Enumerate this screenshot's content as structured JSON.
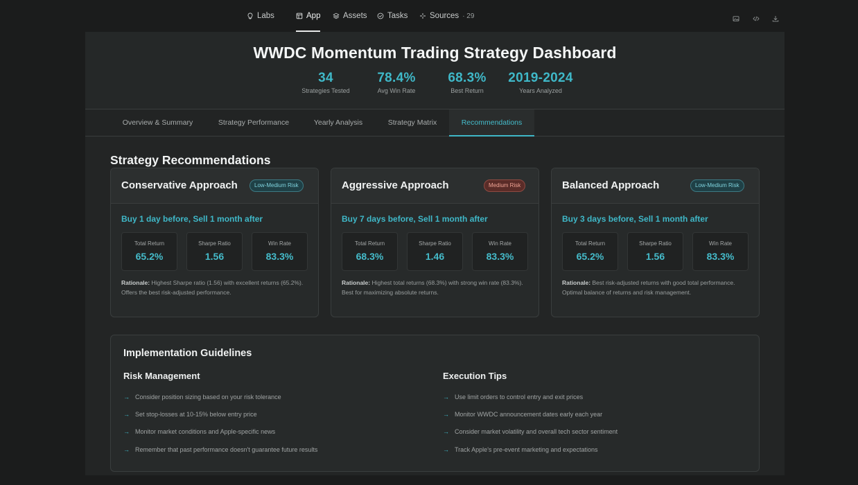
{
  "nav": {
    "items": [
      {
        "label": "Labs",
        "icon": "lightbulb-icon"
      },
      {
        "label": "App",
        "icon": "app-window-icon",
        "active": true
      },
      {
        "label": "Assets",
        "icon": "layers-icon"
      },
      {
        "label": "Tasks",
        "icon": "check-circle-icon"
      },
      {
        "label": "Sources",
        "icon": "sparkle-icon",
        "count": "29"
      }
    ],
    "right_icons": [
      "image-icon",
      "code-icon",
      "download-icon"
    ]
  },
  "hero": {
    "title": "WWDC Momentum Trading Strategy Dashboard",
    "stats": [
      {
        "value": "34",
        "label": "Strategies Tested"
      },
      {
        "value": "78.4%",
        "label": "Avg Win Rate"
      },
      {
        "value": "68.3%",
        "label": "Best Return"
      },
      {
        "value": "2019-2024",
        "label": "Years Analyzed"
      }
    ]
  },
  "tabs": [
    {
      "label": "Overview & Summary"
    },
    {
      "label": "Strategy Performance"
    },
    {
      "label": "Yearly Analysis"
    },
    {
      "label": "Strategy Matrix"
    },
    {
      "label": "Recommendations",
      "active": true
    }
  ],
  "recommendations": {
    "title": "Strategy Recommendations",
    "cards": [
      {
        "title": "Conservative Approach",
        "risk": "Low-Medium Risk",
        "strategy": "Buy 1 day before, Sell 1 month after",
        "metrics": [
          {
            "label": "Total Return",
            "value": "65.2%"
          },
          {
            "label": "Sharpe Ratio",
            "value": "1.56"
          },
          {
            "label": "Win Rate",
            "value": "83.3%"
          }
        ],
        "rationale_label": "Rationale:",
        "rationale": "Highest Sharpe ratio (1.56) with excellent returns (65.2%). Offers the best risk-adjusted performance."
      },
      {
        "title": "Aggressive Approach",
        "risk": "Medium Risk",
        "strategy": "Buy 7 days before, Sell 1 month after",
        "metrics": [
          {
            "label": "Total Return",
            "value": "68.3%"
          },
          {
            "label": "Sharpe Ratio",
            "value": "1.46"
          },
          {
            "label": "Win Rate",
            "value": "83.3%"
          }
        ],
        "rationale_label": "Rationale:",
        "rationale": "Highest total returns (68.3%) with strong win rate (83.3%). Best for maximizing absolute returns."
      },
      {
        "title": "Balanced Approach",
        "risk": "Low-Medium Risk",
        "strategy": "Buy 3 days before, Sell 1 month after",
        "metrics": [
          {
            "label": "Total Return",
            "value": "65.2%"
          },
          {
            "label": "Sharpe Ratio",
            "value": "1.56"
          },
          {
            "label": "Win Rate",
            "value": "83.3%"
          }
        ],
        "rationale_label": "Rationale:",
        "rationale": "Best risk-adjusted returns with good total performance. Optimal balance of returns and risk management."
      }
    ]
  },
  "guidelines": {
    "title": "Implementation Guidelines",
    "risk_title": "Risk Management",
    "risk_items": [
      "Consider position sizing based on your risk tolerance",
      "Set stop-losses at 10-15% below entry price",
      "Monitor market conditions and Apple-specific news",
      "Remember that past performance doesn't guarantee future results"
    ],
    "exec_title": "Execution Tips",
    "exec_items": [
      "Use limit orders to control entry and exit prices",
      "Monitor WWDC announcement dates early each year",
      "Consider market volatility and overall tech sector sentiment",
      "Track Apple's pre-event marketing and expectations"
    ]
  },
  "colors": {
    "accent": "#3fb8c8",
    "badge_teal": "#7fd3de",
    "badge_red": "#f0a394",
    "background": "#1b1c1c"
  }
}
